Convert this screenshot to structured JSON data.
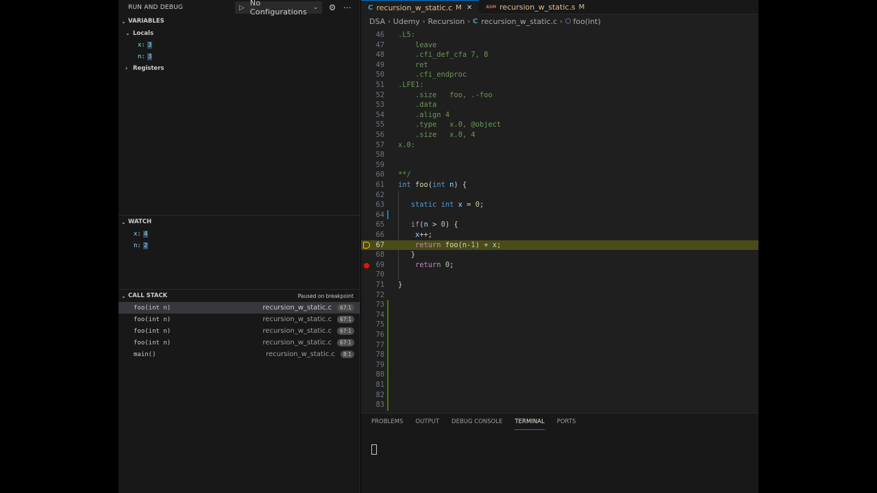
{
  "sidebar": {
    "title": "RUN AND DEBUG",
    "config": "No Configurations",
    "variables": {
      "header": "VARIABLES",
      "locals_label": "Locals",
      "locals": [
        {
          "name": "x:",
          "value": "3"
        },
        {
          "name": "n:",
          "value": "3"
        }
      ],
      "registers_label": "Registers"
    },
    "watch": {
      "header": "WATCH",
      "items": [
        {
          "name": "x:",
          "value": "4"
        },
        {
          "name": "n:",
          "value": "2"
        }
      ]
    },
    "callstack": {
      "header": "CALL STACK",
      "status": "Paused on breakpoint",
      "frames": [
        {
          "fn": "foo(int n)",
          "file": "recursion_w_static.c",
          "pos": "67:1"
        },
        {
          "fn": "foo(int n)",
          "file": "recursion_w_static.c",
          "pos": "67:1"
        },
        {
          "fn": "foo(int n)",
          "file": "recursion_w_static.c",
          "pos": "67:1"
        },
        {
          "fn": "foo(int n)",
          "file": "recursion_w_static.c",
          "pos": "67:1"
        },
        {
          "fn": "main()",
          "file": "recursion_w_static.c",
          "pos": "8:1"
        }
      ]
    }
  },
  "editor": {
    "tabs": [
      {
        "icon": "C",
        "label": "recursion_w_static.c",
        "mod": "M"
      },
      {
        "icon": "ASM",
        "label": "recursion_w_static.s",
        "mod": "M"
      }
    ],
    "breadcrumbs": [
      "DSA",
      "Udemy",
      "Recursion",
      "recursion_w_static.c",
      "foo(int)"
    ],
    "code": [
      {
        "n": "46",
        "t": ".L5:"
      },
      {
        "n": "47",
        "t": "    leave"
      },
      {
        "n": "48",
        "t": "    .cfi_def_cfa 7, 8"
      },
      {
        "n": "49",
        "t": "    ret"
      },
      {
        "n": "50",
        "t": "    .cfi_endproc"
      },
      {
        "n": "51",
        "t": ".LFE1:"
      },
      {
        "n": "52",
        "t": "    .size   foo, .-foo"
      },
      {
        "n": "53",
        "t": "    .data"
      },
      {
        "n": "54",
        "t": "    .align 4"
      },
      {
        "n": "55",
        "t": "    .type   x.0, @object"
      },
      {
        "n": "56",
        "t": "    .size   x.0, 4"
      },
      {
        "n": "57",
        "t": "x.0:"
      },
      {
        "n": "58",
        "t": ""
      },
      {
        "n": "59",
        "t": ""
      },
      {
        "n": "60",
        "t": "**/"
      },
      {
        "n": "61",
        "t": "int foo(int n) {"
      },
      {
        "n": "62",
        "t": ""
      },
      {
        "n": "63",
        "t": "   static int x = 0;"
      },
      {
        "n": "64",
        "t": ""
      },
      {
        "n": "65",
        "t": "   if(n > 0) {"
      },
      {
        "n": "66",
        "t": "    x++;"
      },
      {
        "n": "67",
        "t": "    return foo(n-1) + x;"
      },
      {
        "n": "68",
        "t": "   }"
      },
      {
        "n": "69",
        "t": "    return 0;"
      },
      {
        "n": "70",
        "t": ""
      },
      {
        "n": "71",
        "t": "}"
      },
      {
        "n": "72",
        "t": ""
      },
      {
        "n": "73",
        "t": ""
      },
      {
        "n": "74",
        "t": ""
      },
      {
        "n": "75",
        "t": ""
      },
      {
        "n": "76",
        "t": ""
      },
      {
        "n": "77",
        "t": ""
      },
      {
        "n": "78",
        "t": ""
      },
      {
        "n": "79",
        "t": ""
      },
      {
        "n": "80",
        "t": ""
      },
      {
        "n": "81",
        "t": ""
      },
      {
        "n": "82",
        "t": ""
      },
      {
        "n": "83",
        "t": ""
      }
    ],
    "current_line": "67",
    "breakpoint_line": "69"
  },
  "panel": {
    "tabs": [
      "PROBLEMS",
      "OUTPUT",
      "DEBUG CONSOLE",
      "TERMINAL",
      "PORTS"
    ],
    "active_tab": "TERMINAL"
  },
  "colors": {
    "accent": "#0078d4",
    "current_line_bg": "#4b4b18",
    "breakpoint": "#e51400"
  }
}
